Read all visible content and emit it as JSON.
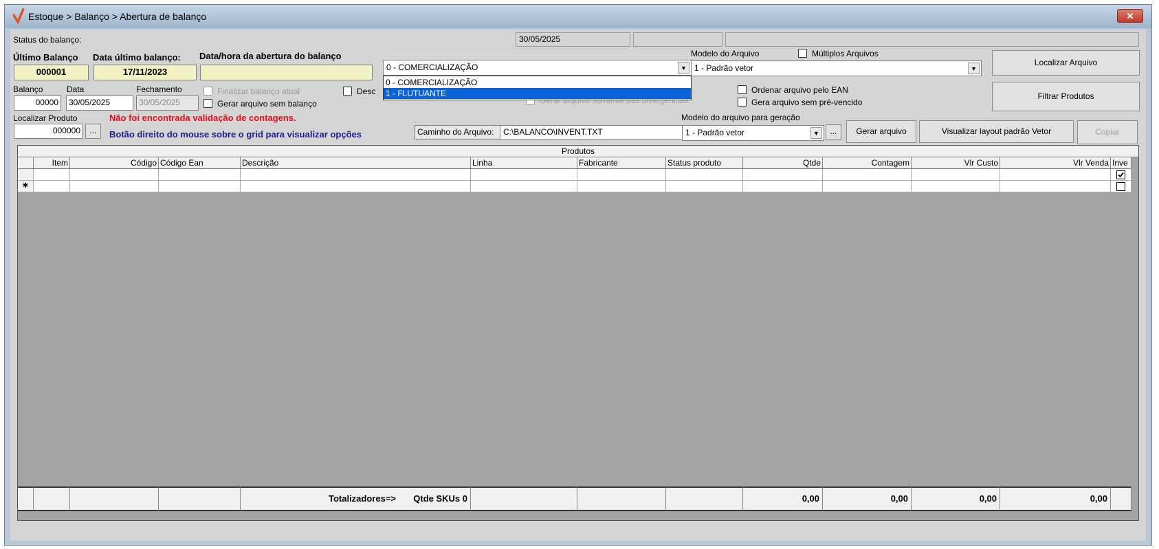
{
  "window": {
    "title": "Estoque > Balanço > Abertura de balanço",
    "close_label": "✕"
  },
  "status": {
    "label": "Status do balanço:",
    "date": "30/05/2025",
    "extra1": "",
    "extra2": ""
  },
  "header": {
    "ultimo_balanco_label": "Último Balanço",
    "ultimo_balanco_value": "000001",
    "data_ultimo_label": "Data último balanço:",
    "data_ultimo_value": "17/11/2023",
    "abertura_label": "Data/hora da abertura do balanço",
    "abertura_value": ""
  },
  "tipo_combo": {
    "value": "0 - COMERCIALIZAÇÃO",
    "options": [
      "0 - COMERCIALIZAÇÃO",
      "1 - FLUTUANTE"
    ],
    "highlighted": "1 - FLUTUANTE"
  },
  "balanco": {
    "balanco_label": "Balanço",
    "balanco_value": "00000",
    "data_label": "Data",
    "data_value": "30/05/2025",
    "fechamento_label": "Fechamento",
    "fechamento_value": "30/05/2025",
    "finalizar_label": "Finalizar balanço atual",
    "gerar_sem_balanco_label": "Gerar arquivo sem balanço",
    "desc_label": "Desc",
    "divergencias_label": "Gerar arquivo somente das divergências"
  },
  "produto": {
    "localizar_label": "Localizar Produto",
    "localizar_value": "000000",
    "ellipsis": "...",
    "error_msg": "Não foi encontrada validação de contagens.",
    "hint_msg": "Botão direito do mouse sobre o grid para visualizar opções"
  },
  "arquivo": {
    "modelo_label": "Modelo do Arquivo",
    "multiplos_label": "Múltiplos Arquivos",
    "modelo_value": "1 - Padrão vetor",
    "ordenar_ean_label": "Ordenar arquivo pelo EAN",
    "pre_vencido_label": "Gera arquivo sem pré-vencido",
    "caminho_label": "Caminho do Arquivo:",
    "caminho_value": "C:\\BALANCO\\INVENT.TXT",
    "modelo_geracao_label": "Modelo do arquivo para geração",
    "modelo_geracao_value": "1 - Padrão vetor",
    "ellipsis": "..."
  },
  "buttons": {
    "localizar_arquivo": "Localizar Arquivo",
    "filtrar_produtos": "Filtrar Produtos",
    "gerar_arquivo": "Gerar arquivo",
    "visualizar_layout": "Visualizar layout padrão Vetor",
    "copiar": "Copiar"
  },
  "grid": {
    "caption": "Produtos",
    "columns": [
      "",
      "Item",
      "Código",
      "Código Ean",
      "Descrição",
      "Linha",
      "Fabricante",
      "Status produto",
      "Qtde",
      "Contagem",
      "Vlr Custo",
      "Vlr Venda",
      "Inve"
    ],
    "rows": [
      {
        "indicator": "",
        "checked": true
      },
      {
        "indicator": "✱",
        "checked": false
      }
    ],
    "totals": {
      "label": "Totalizadores=>",
      "skus": "Qtde SKUs 0",
      "qtde": "0,00",
      "contagem": "0,00",
      "vlr_custo": "0,00",
      "vlr_venda": "0,00"
    }
  }
}
